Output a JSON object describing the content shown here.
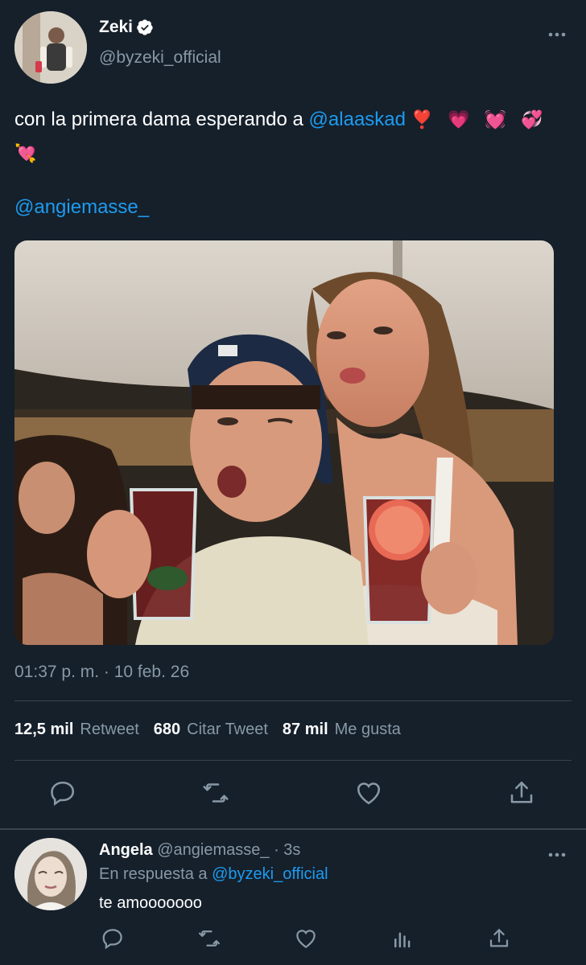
{
  "tweet": {
    "author_name": "Zeki",
    "author_handle": "@byzeki_official",
    "text_before": "con la primera dama esperando a ",
    "mention_1": "@alaaskad",
    "emojis": "❣️ 💗 💓 💞 💘",
    "mention_2": "@angiemasse_",
    "timestamp": "01:37 p. m. · 10 feb. 26",
    "stats": {
      "retweets_count": "12,5 mil",
      "retweets_label": "Retweet",
      "quotes_count": "680",
      "quotes_label": "Citar Tweet",
      "likes_count": "87 mil",
      "likes_label": "Me gusta"
    },
    "actions": [
      "reply-icon",
      "retweet-icon",
      "like-icon",
      "share-icon"
    ]
  },
  "reply": {
    "author_name": "Angela",
    "author_handle": "@angiemasse_",
    "time": " · 3s",
    "in_reply_prefix": "En respuesta a ",
    "in_reply_handle": "@byzeki_official",
    "text": "te amooooooo",
    "actions": [
      "reply-icon",
      "retweet-icon",
      "like-icon",
      "analytics-icon",
      "share-icon"
    ]
  },
  "colors": {
    "background": "#15202b",
    "muted_text": "#8899a6",
    "link": "#1d9bf0",
    "divider": "#38444d",
    "verified": "#ffffff"
  }
}
